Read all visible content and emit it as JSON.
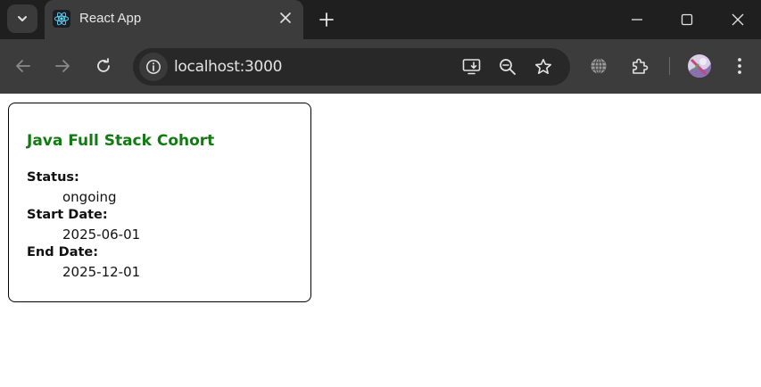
{
  "browser": {
    "tab": {
      "title": "React App",
      "favicon": "react-logo-icon"
    },
    "address_bar": {
      "url": "localhost:3000"
    },
    "icons": {
      "tab_search": "chevron-down-icon",
      "tab_close": "close-icon",
      "new_tab": "plus-icon",
      "minimize": "minimize-icon",
      "maximize": "maximize-icon",
      "close_window": "close-icon",
      "back": "arrow-left-icon",
      "forward": "arrow-right-icon",
      "reload": "reload-icon",
      "site_info": "info-icon",
      "install": "install-app-icon",
      "zoom": "zoom-out-icon",
      "bookmark": "star-icon",
      "translate": "globe-icon",
      "extensions": "puzzle-icon",
      "menu": "kebab-menu-icon"
    }
  },
  "card": {
    "title": "Java Full Stack Cohort",
    "title_color": "#117a11",
    "fields": [
      {
        "label": "Status:",
        "value": "ongoing"
      },
      {
        "label": "Start Date:",
        "value": "2025-06-01"
      },
      {
        "label": "End Date:",
        "value": "2025-12-01"
      }
    ]
  }
}
